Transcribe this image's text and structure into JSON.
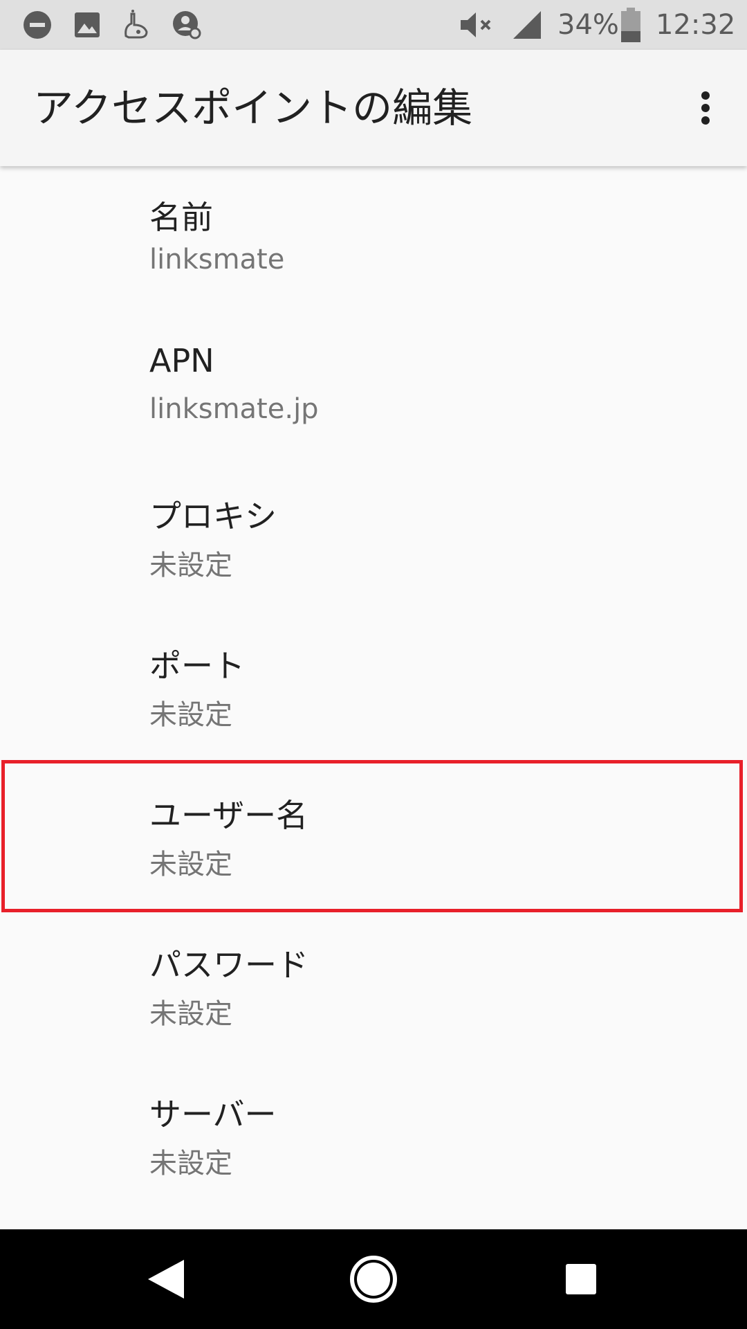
{
  "status_bar": {
    "icons_left": [
      "do-not-disturb-icon",
      "image-icon",
      "app-notification-icon",
      "settings-person-icon"
    ],
    "icons_right": [
      "volume-muted-icon",
      "signal-icon",
      "battery-icon"
    ],
    "battery_percent": "34%",
    "time": "12:32"
  },
  "app_bar": {
    "title": "アクセスポイントの編集",
    "menu_icon": "more-vert-icon"
  },
  "settings": [
    {
      "title": "名前",
      "value": "linksmate"
    },
    {
      "title": "APN",
      "value": "linksmate.jp"
    },
    {
      "title": "プロキシ",
      "value": "未設定"
    },
    {
      "title": "ポート",
      "value": "未設定"
    },
    {
      "title": "ユーザー名",
      "value": "未設定"
    },
    {
      "title": "パスワード",
      "value": "未設定"
    },
    {
      "title": "サーバー",
      "value": "未設定"
    }
  ],
  "highlight_color": "#e8202a",
  "nav_bar": {
    "icons": [
      "back-icon",
      "home-icon",
      "recents-icon"
    ]
  }
}
